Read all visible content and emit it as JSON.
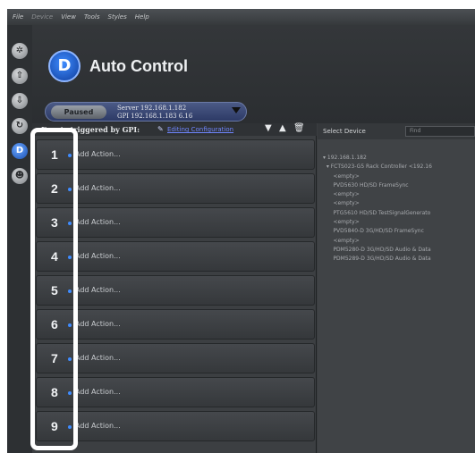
{
  "menu": {
    "items": [
      {
        "label": "File",
        "dim": false
      },
      {
        "label": "Device",
        "dim": true
      },
      {
        "label": "View",
        "dim": false
      },
      {
        "label": "Tools",
        "dim": false
      },
      {
        "label": "Styles",
        "dim": false
      },
      {
        "label": "Help",
        "dim": false
      }
    ]
  },
  "rail": {
    "icons": [
      "settings-icon",
      "upload-icon",
      "download-icon",
      "refresh-icon",
      "auto-control-icon",
      "users-icon"
    ],
    "active_index": 4
  },
  "header": {
    "logo_letter": "D",
    "title": "Auto Control"
  },
  "status": {
    "paused_label": "Paused",
    "server_line": "Server 192.168.1.182",
    "gpi_line": "GPI 192.168.1.183 6.16"
  },
  "events": {
    "label": "Events triggered by GPI:",
    "edit_link": "Editing Configuration",
    "rows": [
      {
        "num": "1",
        "action": "Add Action..."
      },
      {
        "num": "2",
        "action": "Add Action..."
      },
      {
        "num": "3",
        "action": "Add Action..."
      },
      {
        "num": "4",
        "action": "Add Action..."
      },
      {
        "num": "5",
        "action": "Add Action..."
      },
      {
        "num": "6",
        "action": "Add Action..."
      },
      {
        "num": "7",
        "action": "Add Action..."
      },
      {
        "num": "8",
        "action": "Add Action..."
      },
      {
        "num": "9",
        "action": "Add Action..."
      }
    ]
  },
  "device": {
    "title": "Select Device",
    "find_placeholder": "Find",
    "tree": [
      "▾ 192.168.1.182",
      "  ▾ FCTS023-G5 Rack Controller <192.16",
      "      <empty>",
      "      PVD5630 HD/SD FrameSync",
      "      <empty>",
      "      <empty>",
      "      PTG5610 HD/SD TestSignalGenerato",
      "      <empty>",
      "      PVD5840-D 3G/HD/SD FrameSync",
      "      <empty>",
      "      PDM5280-D 3G/HD/SD Audio & Data",
      "      PDM5289-D 3G/HD/SD Audio & Data"
    ]
  },
  "colors": {
    "accent": "#3f8cff",
    "link": "#6f86ff"
  }
}
